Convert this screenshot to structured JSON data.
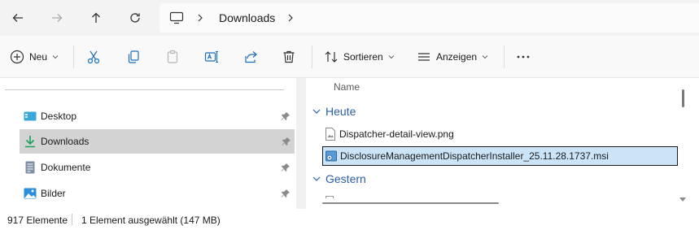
{
  "address_bar": {
    "breadcrumb": "Downloads"
  },
  "command_bar": {
    "new_label": "Neu",
    "sort_label": "Sortieren",
    "view_label": "Anzeigen"
  },
  "nav_pane": {
    "items": [
      {
        "label": "Desktop",
        "icon": "desktop-folder-icon",
        "pinned": true,
        "selected": false
      },
      {
        "label": "Downloads",
        "icon": "download-arrow-icon",
        "pinned": true,
        "selected": true
      },
      {
        "label": "Dokumente",
        "icon": "document-icon",
        "pinned": true,
        "selected": false
      },
      {
        "label": "Bilder",
        "icon": "picture-icon",
        "pinned": true,
        "selected": false
      }
    ]
  },
  "file_list": {
    "column_name": "Name",
    "groups": [
      {
        "label": "Heute",
        "files": [
          {
            "name": "Dispatcher-detail-view.png",
            "icon": "image-file-icon",
            "selected": false
          },
          {
            "name": "DisclosureManagementDispatcherInstaller_25.11.28.1737.msi",
            "icon": "installer-file-icon",
            "selected": true
          }
        ]
      },
      {
        "label": "Gestern",
        "files": []
      }
    ]
  },
  "status_bar": {
    "item_count": "917 Elemente",
    "selection": "1 Element ausgewählt (147 MB)"
  },
  "colors": {
    "accent": "#2b5fa8",
    "selection_bg": "#cce4f7",
    "nav_selected_bg": "#d3d3d3",
    "download_icon": "#1aa05a"
  }
}
